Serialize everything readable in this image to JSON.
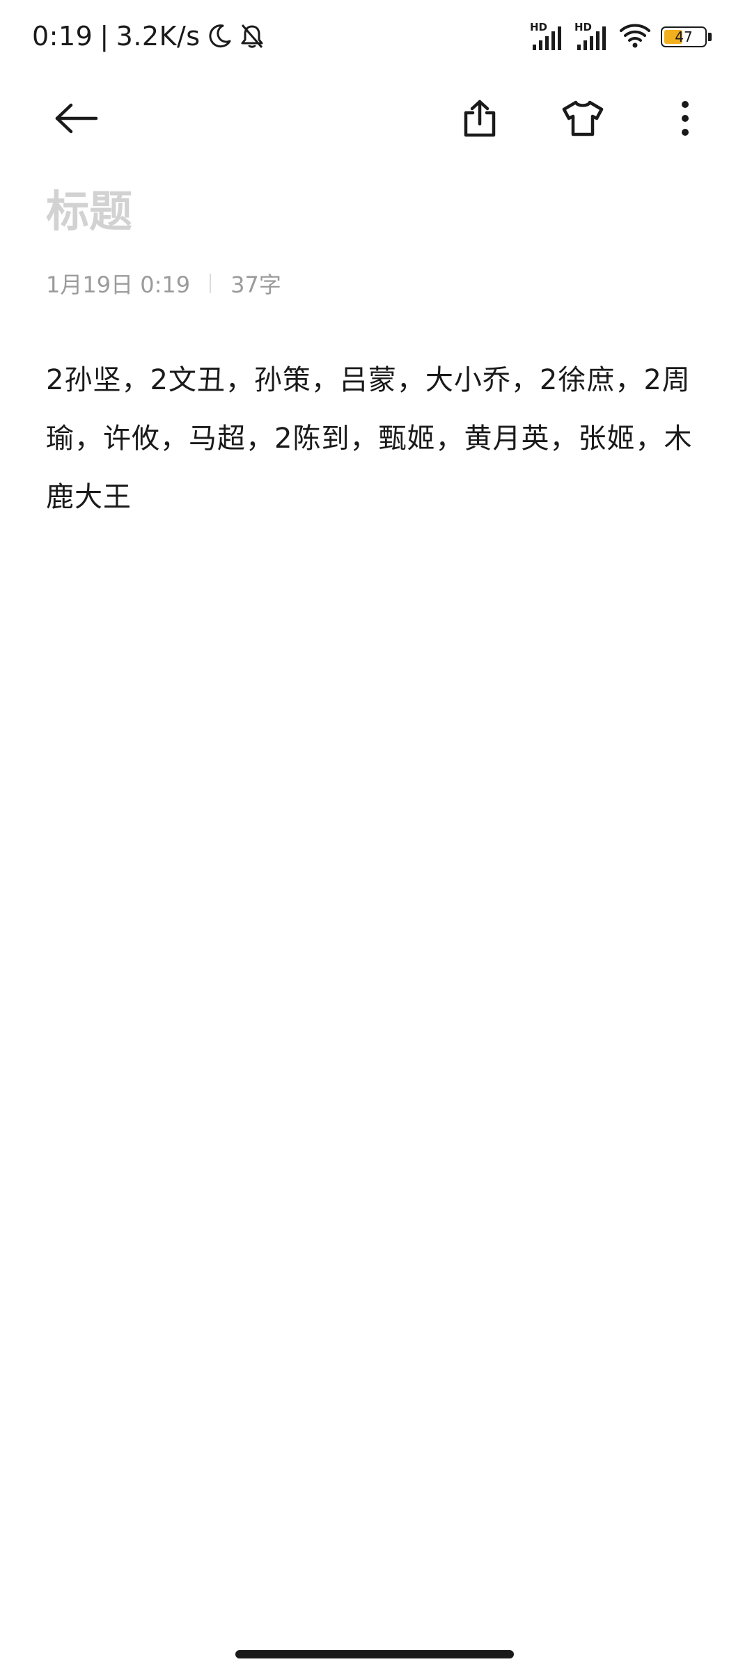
{
  "status_bar": {
    "time": "0:19",
    "separator": "|",
    "net_speed": "3.2K/s",
    "icons": [
      "moon-icon",
      "mute-bell-icon",
      "signal-hd-icon",
      "signal-hd-icon",
      "wifi-icon",
      "battery-icon"
    ],
    "hd_label_1": "HD",
    "hd_label_2": "HD",
    "battery_level": "47",
    "battery_fill_percent": 47,
    "battery_color": "#f2b01e"
  },
  "toolbar": {
    "icons": [
      "back-arrow-icon",
      "share-icon",
      "theme-shirt-icon",
      "more-vert-icon"
    ]
  },
  "note": {
    "title_placeholder": "标题",
    "date": "1月19日 0:19",
    "char_count": "37字",
    "body": "2孙坚，2文丑，孙策，吕蒙，大小乔，2徐庶，2周瑜，许攸，马超，2陈到，甄姬，黄月英，张姬，木鹿大王"
  },
  "colors": {
    "text": "#1a1a1a",
    "placeholder": "#d2d2d2",
    "meta": "#9b9b9b"
  }
}
